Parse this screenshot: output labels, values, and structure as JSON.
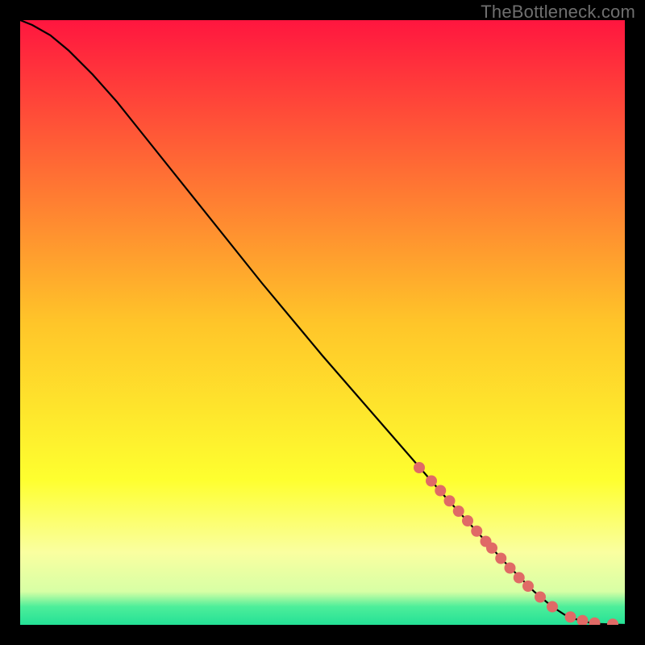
{
  "attribution": "TheBottleneck.com",
  "chart_data": {
    "type": "line",
    "title": "",
    "xlabel": "",
    "ylabel": "",
    "xlim": [
      0,
      100
    ],
    "ylim": [
      0,
      100
    ],
    "grid": false,
    "legend": false,
    "background_gradient": {
      "stops": [
        {
          "offset": 0.0,
          "color": "#ff163f"
        },
        {
          "offset": 0.5,
          "color": "#ffc529"
        },
        {
          "offset": 0.76,
          "color": "#feff2f"
        },
        {
          "offset": 0.88,
          "color": "#faffa0"
        },
        {
          "offset": 0.945,
          "color": "#d7ffa5"
        },
        {
          "offset": 0.97,
          "color": "#4dee9a"
        },
        {
          "offset": 1.0,
          "color": "#24e196"
        }
      ]
    },
    "series": [
      {
        "name": "bottleneck-curve",
        "color": "#000000",
        "x": [
          0,
          2,
          5,
          8,
          12,
          16,
          20,
          30,
          40,
          50,
          60,
          70,
          80,
          85,
          88,
          90,
          92,
          94,
          96,
          98,
          100
        ],
        "y": [
          100,
          99.2,
          97.5,
          95,
          91,
          86.5,
          81.5,
          69,
          56.5,
          44.5,
          33,
          21.5,
          10.5,
          5.5,
          3,
          1.7,
          0.9,
          0.4,
          0.15,
          0.05,
          0
        ]
      }
    ],
    "markers": {
      "name": "highlighted-points",
      "color": "#e06a66",
      "radius_px": 7,
      "x": [
        66,
        68,
        69.5,
        71,
        72.5,
        74,
        75.5,
        77,
        78,
        79.5,
        81,
        82.5,
        84,
        86,
        88,
        91,
        93,
        95,
        98
      ],
      "y": [
        26,
        23.8,
        22.2,
        20.5,
        18.8,
        17.2,
        15.5,
        13.8,
        12.7,
        11,
        9.4,
        7.8,
        6.4,
        4.6,
        3,
        1.3,
        0.7,
        0.3,
        0.1
      ]
    }
  }
}
